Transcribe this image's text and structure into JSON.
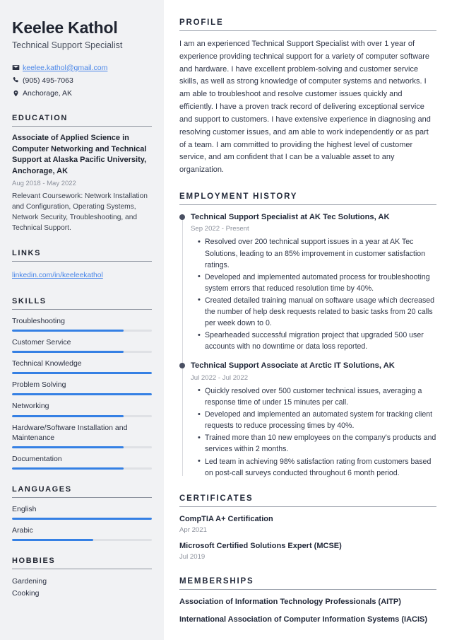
{
  "theme": {
    "accent_blue": "#3580e4",
    "link_blue": "#4a86e8",
    "sidebar_bg": "#f1f2f4",
    "heading_color": "#22293a",
    "muted_color": "#8c919c",
    "timeline_dot": "#4a5063"
  },
  "header": {
    "name": "Keelee Kathol",
    "job_title": "Technical Support Specialist"
  },
  "contact": {
    "email": "keelee.kathol@gmail.com",
    "phone": "(905) 495-7063",
    "location": "Anchorage, AK",
    "icons": {
      "email": "envelope-icon",
      "phone": "phone-icon",
      "location": "map-pin-icon"
    }
  },
  "sidebar": {
    "education": {
      "heading": "EDUCATION",
      "items": [
        {
          "title": "Associate of Applied Science in Computer Networking and Technical Support at Alaska Pacific University, Anchorage, AK",
          "date": "Aug 2018 - May 2022",
          "description": "Relevant Coursework: Network Installation and Configuration, Operating Systems, Network Security, Troubleshooting, and Technical Support."
        }
      ]
    },
    "links": {
      "heading": "LINKS",
      "items": [
        {
          "label": "linkedin.com/in/keeleekathol"
        }
      ]
    },
    "skills": {
      "heading": "SKILLS",
      "items": [
        {
          "label": "Troubleshooting",
          "level": 80
        },
        {
          "label": "Customer Service",
          "level": 80
        },
        {
          "label": "Technical Knowledge",
          "level": 100
        },
        {
          "label": "Problem Solving",
          "level": 100
        },
        {
          "label": "Networking",
          "level": 80
        },
        {
          "label": "Hardware/Software Installation and Maintenance",
          "level": 80
        },
        {
          "label": "Documentation",
          "level": 80
        }
      ]
    },
    "languages": {
      "heading": "LANGUAGES",
      "items": [
        {
          "label": "English",
          "level": 100
        },
        {
          "label": "Arabic",
          "level": 58
        }
      ]
    },
    "hobbies": {
      "heading": "HOBBIES",
      "items": [
        {
          "label": "Gardening"
        },
        {
          "label": "Cooking"
        }
      ]
    }
  },
  "main": {
    "profile": {
      "heading": "PROFILE",
      "text": "I am an experienced Technical Support Specialist with over 1 year of experience providing technical support for a variety of computer software and hardware. I have excellent problem-solving and customer service skills, as well as strong knowledge of computer systems and networks. I am able to troubleshoot and resolve customer issues quickly and efficiently. I have a proven track record of delivering exceptional service and support to customers. I have extensive experience in diagnosing and resolving customer issues, and am able to work independently or as part of a team. I am committed to providing the highest level of customer service, and am confident that I can be a valuable asset to any organization."
    },
    "employment": {
      "heading": "EMPLOYMENT HISTORY",
      "jobs": [
        {
          "title": "Technical Support Specialist at AK Tec Solutions, AK",
          "date": "Sep 2022 - Present",
          "bullets": [
            "Resolved over 200 technical support issues in a year at AK Tec Solutions, leading to an 85% improvement in customer satisfaction ratings.",
            "Developed and implemented automated process for troubleshooting system errors that reduced resolution time by 40%.",
            "Created detailed training manual on software usage which decreased the number of help desk requests related to basic tasks from 20 calls per week down to 0.",
            "Spearheaded successful migration project that upgraded 500 user accounts with no downtime or data loss reported."
          ]
        },
        {
          "title": "Technical Support Associate at Arctic IT Solutions, AK",
          "date": "Jul 2022 - Jul 2022",
          "bullets": [
            "Quickly resolved over 500 customer technical issues, averaging a response time of under 15 minutes per call.",
            "Developed and implemented an automated system for tracking client requests to reduce processing times by 40%.",
            "Trained more than 10 new employees on the company's products and services within 2 months.",
            "Led team in achieving 98% satisfaction rating from customers based on post-call surveys conducted throughout 6 month period."
          ]
        }
      ]
    },
    "certificates": {
      "heading": "CERTIFICATES",
      "items": [
        {
          "title": "CompTIA A+ Certification",
          "date": "Apr 2021"
        },
        {
          "title": "Microsoft Certified Solutions Expert (MCSE)",
          "date": "Jul 2019"
        }
      ]
    },
    "memberships": {
      "heading": "MEMBERSHIPS",
      "items": [
        {
          "label": "Association of Information Technology Professionals (AITP)"
        },
        {
          "label": "International Association of Computer Information Systems (IACIS)"
        }
      ]
    }
  }
}
